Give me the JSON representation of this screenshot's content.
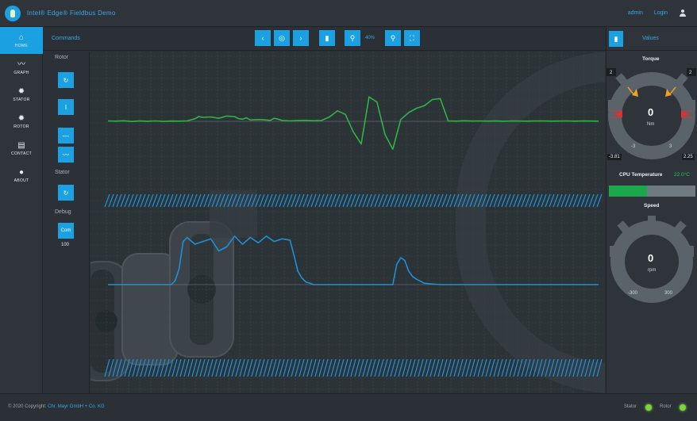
{
  "header": {
    "app_title": "Intel® Edge® Fieldbus Demo",
    "admin_label": "admin",
    "login_label": "Login"
  },
  "sidebar": {
    "items": [
      {
        "label": "HOME",
        "icon": "home-icon",
        "glyph": "⌂"
      },
      {
        "label": "GRAPH",
        "icon": "graph-icon",
        "glyph": "〰"
      },
      {
        "label": "STATOR",
        "icon": "gear-icon",
        "glyph": "✹"
      },
      {
        "label": "ROTOR",
        "icon": "gear-icon",
        "glyph": "✹"
      },
      {
        "label": "CONTACT",
        "icon": "document-icon",
        "glyph": "▤"
      },
      {
        "label": "ABOUT",
        "icon": "info-icon",
        "glyph": "●"
      }
    ]
  },
  "toolbar": {
    "title": "Commands",
    "zoom": "40%",
    "buttons": [
      {
        "name": "prev-button",
        "glyph": "‹"
      },
      {
        "name": "target-button",
        "glyph": "◎"
      },
      {
        "name": "next-button",
        "glyph": "›"
      },
      {
        "name": "battery-button",
        "glyph": "▮"
      },
      {
        "name": "zoom-out-button",
        "glyph": "⚲"
      },
      {
        "name": "zoom-in-button",
        "glyph": "⚲"
      },
      {
        "name": "fullscreen-button",
        "glyph": "⛶"
      }
    ]
  },
  "controls": {
    "rotor_label": "Rotor",
    "stator_label": "Stator",
    "debug_label": "Debug",
    "debug_value": "100",
    "rotor_buttons": [
      "↻",
      "I",
      "—",
      "〰"
    ],
    "stator_button": "↻",
    "debug_button": "Com"
  },
  "chart_data": [
    {
      "type": "line",
      "title": "",
      "series": [
        {
          "color": "#2fb344",
          "x": [
            0,
            10,
            20,
            30,
            40,
            50,
            60,
            70,
            80,
            90,
            100,
            110,
            115,
            120,
            130,
            140,
            150,
            160,
            165,
            170,
            175,
            180,
            190,
            200,
            205,
            210,
            215,
            220,
            230,
            240,
            250,
            260,
            270,
            280,
            290,
            300,
            310,
            320,
            330,
            340,
            350,
            360,
            370,
            380,
            390,
            400,
            410,
            420,
            430,
            440,
            450,
            460,
            470,
            480,
            490,
            500,
            510,
            520,
            530,
            540,
            550,
            560,
            570,
            580,
            590,
            600,
            610,
            620
          ],
          "y": [
            0.05,
            0.02,
            0.06,
            -0.02,
            0.04,
            0.01,
            0.05,
            -0.01,
            0.03,
            0.02,
            0.05,
            0.3,
            0.55,
            0.45,
            0.5,
            0.35,
            0.6,
            0.55,
            0.3,
            0.25,
            0.4,
            0.15,
            0.2,
            0.15,
            0.1,
            0.35,
            0.25,
            0.1,
            0.05,
            0.08,
            0.1,
            0.06,
            0.1,
            0.5,
            1.2,
            0.8,
            -1.2,
            -2.6,
            2.8,
            2.2,
            -1.5,
            -3.2,
            0.2,
            1.0,
            1.5,
            1.8,
            2.5,
            2.6,
            0.05,
            0.02,
            0.06,
            0.03,
            0.05,
            0.02,
            0.04,
            0.01,
            0.05,
            0.03,
            0.02,
            0.04,
            0.05,
            0.02,
            0.03,
            0.05,
            0.02,
            0.04,
            0.03,
            0.02
          ]
        }
      ]
    },
    {
      "type": "line",
      "title": "",
      "series": [
        {
          "color": "#1e90d6",
          "x": [
            0,
            20,
            40,
            60,
            80,
            85,
            90,
            95,
            100,
            110,
            120,
            130,
            140,
            150,
            160,
            170,
            180,
            190,
            200,
            210,
            220,
            230,
            235,
            240,
            245,
            250,
            255,
            260,
            270,
            280,
            300,
            320,
            340,
            360,
            365,
            370,
            375,
            380,
            385,
            390,
            400,
            420,
            440,
            460,
            480,
            500,
            520,
            540,
            560,
            580,
            600,
            620
          ],
          "y": [
            0,
            0,
            0,
            0,
            0,
            0.3,
            1.2,
            3.2,
            3.5,
            3.0,
            3.2,
            3.4,
            2.5,
            2.8,
            3.6,
            3.0,
            3.5,
            3.1,
            3.6,
            3.2,
            3.4,
            3.3,
            2.2,
            1.0,
            0.5,
            0.2,
            0.1,
            0,
            0,
            0,
            0,
            0,
            0,
            0,
            1.5,
            2.0,
            1.8,
            1.0,
            0.6,
            0.4,
            0.1,
            0,
            0,
            0,
            0,
            0,
            0,
            0,
            0,
            0,
            0,
            0
          ]
        }
      ]
    }
  ],
  "right_panel": {
    "title": "Values",
    "torque": {
      "title": "Torque",
      "value": "0",
      "unit": "Nm",
      "max_left": "2",
      "max_right": "2",
      "scale_min": "-3",
      "scale_max": "3",
      "readout_left": "-3.81",
      "readout_right": "2.25",
      "accent_color": "#f0a020",
      "alarm_color": "#e23030"
    },
    "cpu": {
      "title": "CPU Temperature",
      "value": "22.0°C",
      "fill_fraction": 0.44
    },
    "speed": {
      "title": "Speed",
      "value": "0",
      "unit": "rpm",
      "scale_min": "-300",
      "scale_max": "300"
    }
  },
  "footer": {
    "copyright": "© 2020 Copyright:",
    "company_link": "Chr. Mayr GmbH + Co. KG",
    "stator_label": "Stator",
    "rotor_label": "Rotor",
    "led_color": "#7ad63a"
  }
}
